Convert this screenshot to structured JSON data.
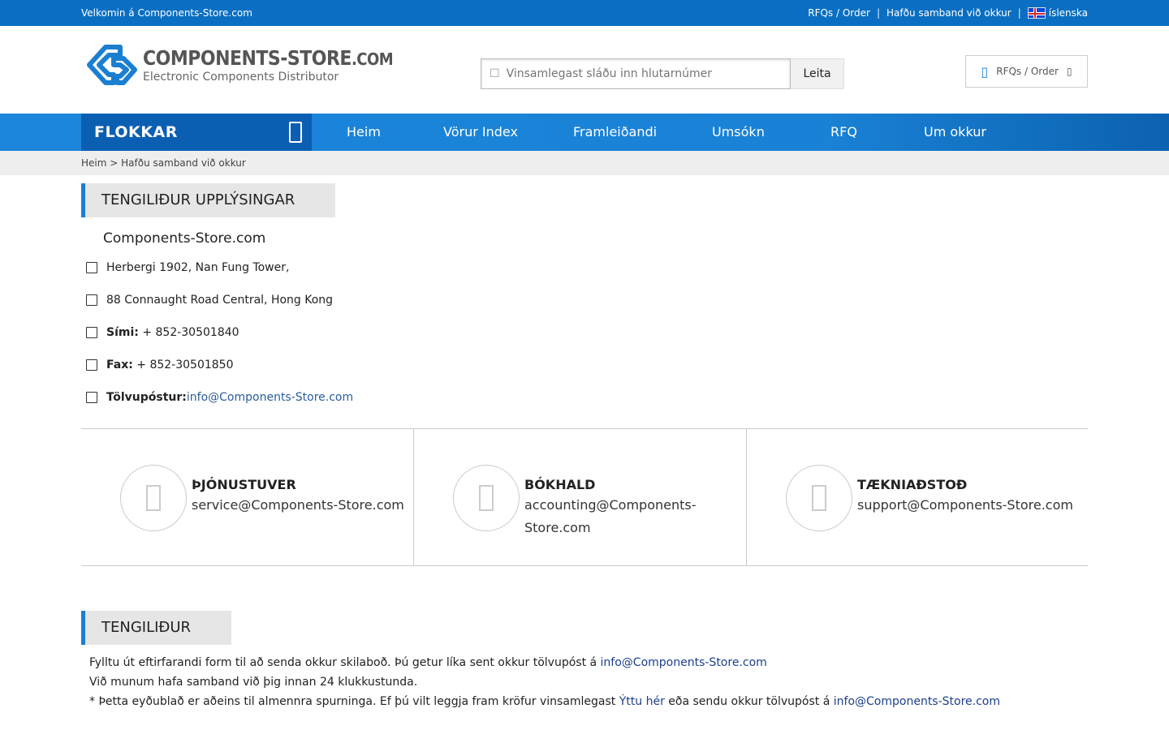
{
  "topbar": {
    "welcome": "Velkomin á Components-Store.com",
    "links": [
      "RFQs / Order",
      "Hafðu samband við okkur"
    ],
    "separator": "|",
    "language": "íslenska"
  },
  "header": {
    "logo_brand": "COMPONENTS-STORE",
    "logo_com": ".COM",
    "logo_tagline": "Electronic Components Distributor",
    "search_placeholder": "Vinsamlegast sláðu inn hlutarnúmer",
    "search_button": "Leita",
    "cart_label": "RFQs / Order"
  },
  "nav": {
    "categories": "FLOKKAR",
    "items": [
      "Heim",
      "Vörur Index",
      "Framleiðandi",
      "Umsókn",
      "RFQ",
      "Um okkur"
    ]
  },
  "breadcrumb": {
    "home": "Heim",
    "sep": ">",
    "current": "Hafðu samband við okkur"
  },
  "contact_info": {
    "title": "TENGILIÐUR UPPLÝSINGAR",
    "company": "Components-Store.com",
    "address1": "Herbergi 1902, Nan Fung Tower,",
    "address2": "88 Connaught Road Central, Hong Kong",
    "phone_label": "Sími:",
    "phone": " + 852-30501840",
    "fax_label": "Fax:",
    "fax": " + 852-30501850",
    "email_label": "Tölvupóstur:",
    "email": "info@Components-Store.com"
  },
  "departments": [
    {
      "title": "ÞJÓNUSTUVER",
      "email": "service@Components-Store.com"
    },
    {
      "title": "BÓKHALD",
      "email": "accounting@Components-Store.com"
    },
    {
      "title": "TÆKNIAÐSTOÐ",
      "email": "support@Components-Store.com"
    }
  ],
  "contact_form": {
    "title": "TENGILIÐUR",
    "line1_text": "Fylltu út eftirfarandi form til að senda okkur skilaboð. Þú getur líka sent okkur tölvupóst á ",
    "line1_email": "info@Components-Store.com",
    "line2": "Við munum hafa samband við þig innan 24 klukkustunda.",
    "line3_text1": "* Þetta eyðublað er aðeins til almennra spurninga. Ef þú vilt leggja fram kröfur vinsamlegast ",
    "line3_link": "Ýttu hér",
    "line3_text2": " eða sendu okkur tölvupóst á ",
    "line3_email": "info@Components-Store.com"
  },
  "colors": {
    "topbar": "#0a6fc2",
    "nav": "#1b86dc",
    "categories": "#0b5fb3",
    "accent": "#1a7fd0"
  }
}
